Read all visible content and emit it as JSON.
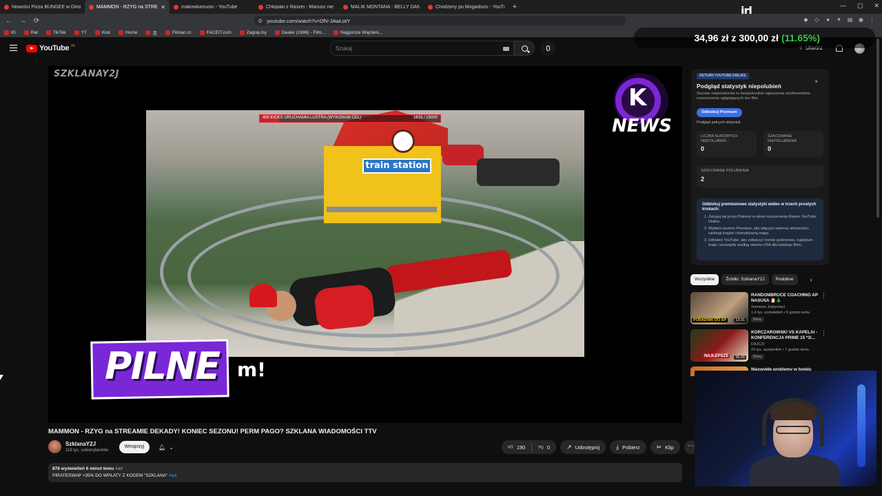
{
  "browser": {
    "tabs": [
      {
        "title": "Nowości Pizza BUNGEE w Dino 🍕🎈",
        "active": false
      },
      {
        "title": "MAMMON - RZYG na STREAMIE",
        "active": true
      },
      {
        "title": "makowkamusic - YouTube",
        "active": false
      },
      {
        "title": "Chłopaki z Raszei - Mariusz nie chce",
        "active": false
      },
      {
        "title": "MALIK MONTANA - BELLY DANCE X",
        "active": false
      },
      {
        "title": "Chodzimy po Mogadiszu - YouTube",
        "active": false
      }
    ],
    "new_tab": "+",
    "url": "youtube.com/watch?v=DfV-JAwLotY",
    "bookmarks": [
      "IG",
      "Rat",
      "TikTok",
      "YT",
      "Kick",
      "Home",
      "且",
      "Filman.cc",
      "FACEIT.com",
      "Zagraj.my",
      "Dealer (1996) - Film...",
      "Najgorsze Więzieni..."
    ]
  },
  "youtube": {
    "logo_text": "YouTube",
    "logo_country": "PL",
    "search_placeholder": "Szukaj",
    "create_label": "Utwórz"
  },
  "overlay": {
    "irl_logo": "irl",
    "donation_current": "34,96 zł",
    "donation_sep": "z",
    "donation_goal": "300,00 zł",
    "donation_pct": "(11.65%)",
    "donation_progress": 0.1165
  },
  "player": {
    "watermark": "SZKLANAY2J",
    "news_logo_k": "K",
    "news_logo_text": "NEWS",
    "goal_text": "400 KICKS URUCHAMIA LUSTRA (WYKONAM CEL)",
    "goal_count": "1615 / 15000",
    "goal_progress": 0.1077,
    "station_sign": "train station",
    "banner_text": "PILNE",
    "banner_tail": "m!"
  },
  "video": {
    "title": "MAMMON - RZYG na STREAMIE DEKADY! KONIEC SEZONU! PERM PAGO? SZKLANA WIADOMOŚCI TTV",
    "channel_name": "SzklanaY2J",
    "subscribers": "118 tys. subskrybentów",
    "support_label": "Wesprzyj",
    "likes": "190",
    "dislikes": "0",
    "share_label": "Udostępnij",
    "download_label": "Pobierz",
    "clip_label": "Klip",
    "views_line": "878 wyświetleń  6 minut temu",
    "views_tag": "#ad",
    "desc_line": "PIRATESWAP +35% DO WPŁATY Z KODEM \"SZKLANA\"",
    "desc_tag": "#ad"
  },
  "ryd": {
    "badge": "RETURN YOUTUBE DISLIKE",
    "close": "×",
    "title": "Podgląd statystyk niepolubień",
    "description": "Surowe niepolubienia to bezpośrednie zgłoszenia użytkowników rozszerzenia oglądających ten film.",
    "unlock_btn": "Odblokuj Premium",
    "full_stats_link": "Podgląd pełnych statystyk",
    "stat1_label": "LICZBA SUROWYCH NIEPOLUBIEŃ",
    "stat1_value": "0",
    "stat2_label": "SZACOWANE NIEPOLUBIENIA",
    "stat2_value": "0",
    "stat3_label": "SZACOWANE POLUBIENIA",
    "stat3_value": "2",
    "info_heading": "Odblokuj premiumowe statystyki wideo w trzech prostych krokach:",
    "info_steps": [
      "Zaloguj się przez Patreon w oknie rozszerzenia Return YouTube Dislike.",
      "Wybierz poziom Premium, aby włączyć wykresy aktywności, rankingi krajów i interaktywną mapę.",
      "Odśwież YouTube, aby zobaczyć trendy godzinowe, najlepsze kraje i szczegóły według stanów USA dla każdego filmu."
    ]
  },
  "chips": [
    "Wszystkie",
    "Źródło: SzklanaY2J",
    "Podobne"
  ],
  "recommendations": [
    {
      "title": "RANDOMBRUCE COACHING AP NASUSA 🎅🎄",
      "channel": "Teemiorz Zadymiorz",
      "meta": "1,4 tys. wyświetleń • 5 godzin temu",
      "badge": "Nowy",
      "duration": "13:31",
      "thumb_text": "PORADNIK DO AP"
    },
    {
      "title": "KORCZAROWSKI VS KAPELAI - KONFERENCJA PRIME 15 *3/...",
      "channel": "DAJCZI",
      "meta": "23 tys. wyświetleń • 7 godzin temu",
      "badge": "Nowy",
      "duration": "36:26",
      "thumb_text": "NAJLEPSZE"
    },
    {
      "title": "Niezwykłe problemy w hotelu",
      "channel": "",
      "meta": "",
      "badge": "",
      "duration": "",
      "thumb_text": ""
    }
  ],
  "colors": {
    "accent_red": "#ff0000",
    "donation_green": "#2ecc40",
    "banner_purple": "#7a27d8",
    "ryd_blue": "#3b6fe4"
  }
}
